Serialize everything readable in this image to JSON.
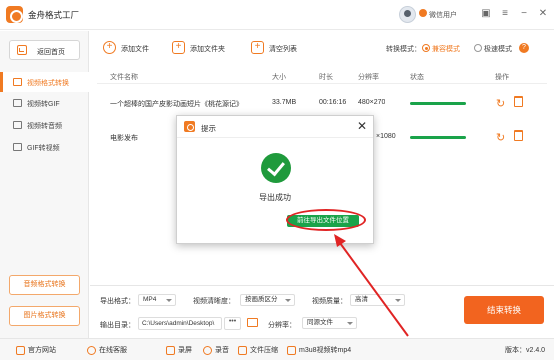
{
  "titlebar": {
    "app_title": "金舟格式工厂",
    "user_name": "微信用户",
    "icons": [
      "skin-icon",
      "menu-icon",
      "minimize-icon",
      "close-icon"
    ]
  },
  "sidebar": {
    "back_label": "返回首页",
    "items": [
      {
        "label": "视频格式转换",
        "icon": "video-convert-icon",
        "active": true
      },
      {
        "label": "视频转GIF",
        "icon": "video-gif-icon",
        "active": false
      },
      {
        "label": "视频转音频",
        "icon": "video-audio-icon",
        "active": false
      },
      {
        "label": "GIF转视频",
        "icon": "gif-video-icon",
        "active": false
      }
    ],
    "bottom_buttons": [
      "音频格式转换",
      "图片格式转换"
    ]
  },
  "toolbar": {
    "add_file": "添加文件",
    "add_folder": "添加文件夹",
    "clear_list": "清空列表",
    "mode_label": "转换模式：",
    "mode_options": [
      "兼容模式",
      "极速模式"
    ],
    "mode_selected": "兼容模式"
  },
  "table": {
    "headers": [
      "文件名称",
      "大小",
      "时长",
      "分辨率",
      "状态",
      "操作"
    ],
    "rows": [
      {
        "name": "一个超棒的国产皮影动画短片《桃花源记》",
        "size": "33.7MB",
        "duration": "00:16:16",
        "resolution": "480×270",
        "progress": 1.0
      },
      {
        "name": "电影发布",
        "size": "",
        "duration": "",
        "resolution": "×1080",
        "progress": 1.0
      }
    ]
  },
  "bottom": {
    "format_label": "导出格式：",
    "format_value": "MP4",
    "clarity_label": "视频清晰度：",
    "clarity_value": "按画质区分",
    "quality_label": "视频质量：",
    "quality_value": "高清",
    "output_label": "输出目录：",
    "output_path": "C:\\Users\\admin\\Desktop\\",
    "more": "•••",
    "resolution_label": "分辨率：",
    "resolution_value": "同源文件",
    "start_button": "结束转换"
  },
  "statusbar": {
    "items": [
      {
        "label": "官方网站",
        "icon": "home-icon"
      },
      {
        "label": "在线客服",
        "icon": "support-icon"
      },
      {
        "label": "录屏",
        "icon": "record-screen-icon"
      },
      {
        "label": "录音",
        "icon": "record-audio-icon"
      },
      {
        "label": "文件压缩",
        "icon": "compress-icon"
      },
      {
        "label": "m3u8视频转mp4",
        "icon": "m3u8-icon"
      }
    ],
    "version": "版本：v2.4.0"
  },
  "dialog": {
    "title": "提示",
    "message": "导出成功",
    "button": "前往导出文件位置"
  },
  "colors": {
    "accent": "#f07a22",
    "success": "#1aa34a",
    "annotation": "#e02424",
    "start_button": "#f2641f"
  }
}
